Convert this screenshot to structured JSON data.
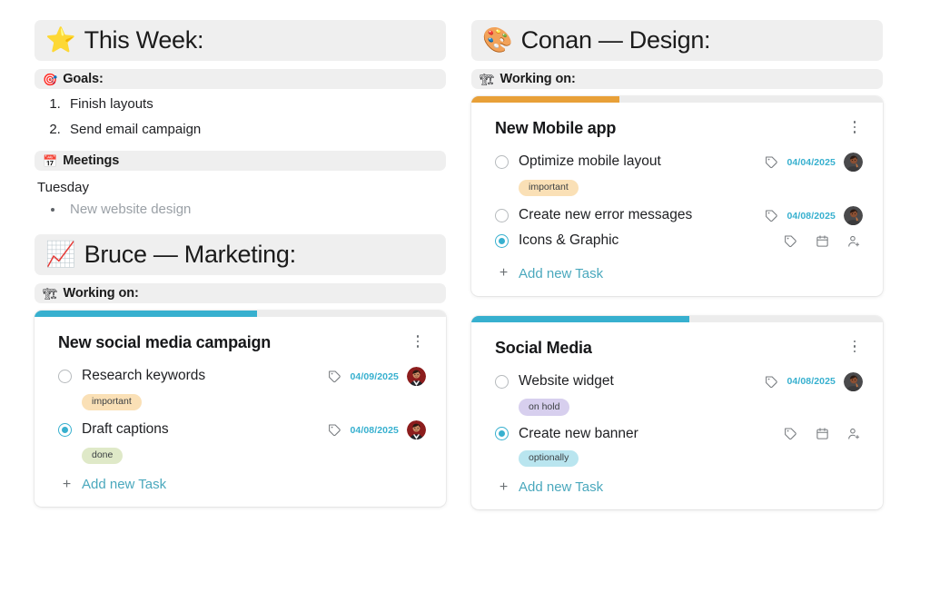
{
  "colors": {
    "accent_teal": "#37b0cf",
    "accent_orange": "#e8a038",
    "banner_bg": "#efefef",
    "link_teal": "#4aa8bd",
    "tag_important": "#fae0b6",
    "tag_done": "#dfe9c8",
    "tag_on_hold": "#d7cfee",
    "tag_optionally": "#b9e5ef"
  },
  "left_column": {
    "week_header": {
      "emoji": "⭐",
      "icon": "star-icon",
      "title": "This Week:"
    },
    "goals_header": {
      "emoji": "🎯",
      "icon": "target-icon",
      "title": "Goals:"
    },
    "goals": [
      "Finish layouts",
      "Send email campaign"
    ],
    "meetings_header": {
      "emoji": "📅",
      "icon": "calendar-icon",
      "title": "Meetings"
    },
    "meetings_day": "Tuesday",
    "meetings": [
      "New website design"
    ],
    "person_header": {
      "emoji": "📈",
      "icon": "chart-increasing-icon",
      "title": "Bruce — Marketing:"
    },
    "working_header": {
      "emoji": "🏗",
      "icon": "construction-icon",
      "title": "Working on:"
    },
    "cards": [
      {
        "title": "New social media campaign",
        "progress_percent": 54,
        "progress_color": "#37b0cf",
        "menu_icon": "kebab-menu-icon",
        "add_task_label": "Add new Task",
        "tasks": [
          {
            "name": "Research keywords",
            "checked": false,
            "date": "04/09/2025",
            "tag": "important",
            "tag_color": "#fae0b6",
            "avatar": "avatar-bruce",
            "icons": [
              "tag-icon"
            ]
          },
          {
            "name": "Draft captions",
            "checked": true,
            "date": "04/08/2025",
            "tag": "done",
            "tag_color": "#dfe9c8",
            "avatar": "avatar-bruce",
            "icons": [
              "tag-icon"
            ]
          }
        ]
      }
    ]
  },
  "right_column": {
    "person_header": {
      "emoji": "🎨",
      "icon": "artist-palette-icon",
      "title": "Conan — Design:"
    },
    "working_header": {
      "emoji": "🏗",
      "icon": "construction-icon",
      "title": "Working on:"
    },
    "cards": [
      {
        "title": "New Mobile app",
        "progress_percent": 36,
        "progress_color": "#e8a038",
        "menu_icon": "kebab-menu-icon",
        "add_task_label": "Add new Task",
        "tasks": [
          {
            "name": "Optimize mobile layout",
            "checked": false,
            "date": "04/04/2025",
            "tag": "important",
            "tag_color": "#fae0b6",
            "avatar": "avatar-conan",
            "icons": [
              "tag-icon"
            ]
          },
          {
            "name": "Create new error messages",
            "checked": false,
            "date": "04/08/2025",
            "tag": null,
            "tag_color": null,
            "avatar": "avatar-conan",
            "icons": [
              "tag-icon"
            ]
          },
          {
            "name": "Icons & Graphic",
            "checked": true,
            "date": null,
            "tag": null,
            "tag_color": null,
            "avatar": null,
            "icons": [
              "tag-icon",
              "calendar-icon",
              "add-person-icon"
            ]
          }
        ]
      },
      {
        "title": "Social Media",
        "progress_percent": 53,
        "progress_color": "#37b0cf",
        "menu_icon": "kebab-menu-icon",
        "add_task_label": "Add new Task",
        "tasks": [
          {
            "name": "Website widget",
            "checked": false,
            "date": "04/08/2025",
            "tag": "on hold",
            "tag_color": "#d7cfee",
            "avatar": "avatar-conan",
            "icons": [
              "tag-icon"
            ]
          },
          {
            "name": "Create new banner",
            "checked": true,
            "date": null,
            "tag": "optionally",
            "tag_color": "#b9e5ef",
            "avatar": null,
            "icons": [
              "tag-icon",
              "calendar-icon",
              "add-person-icon"
            ]
          }
        ]
      }
    ]
  }
}
